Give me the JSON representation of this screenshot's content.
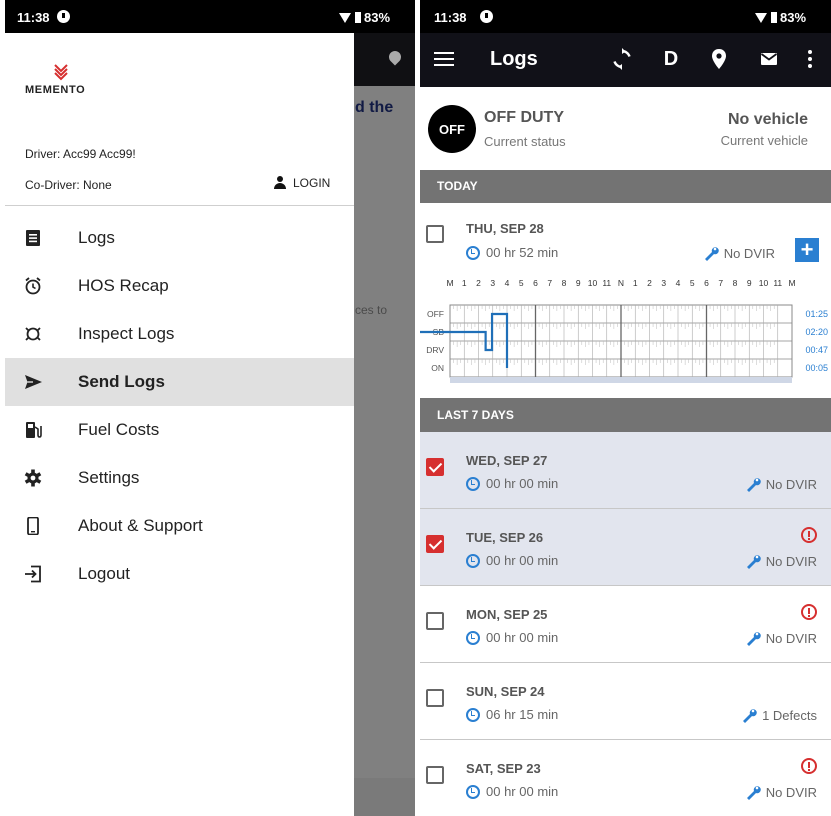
{
  "left_phone": {
    "status_bar": {
      "time": "11:38",
      "battery": "83%"
    },
    "behind": {
      "text1": "d the",
      "text2": "ces to"
    },
    "drawer": {
      "logo_text": "MEMENTO",
      "driver": "Driver: Acc99 Acc99!",
      "codriver": "Co-Driver: None",
      "login_label": "LOGIN",
      "menu": [
        {
          "label": "Logs",
          "icon": "list-icon"
        },
        {
          "label": "HOS Recap",
          "icon": "alarm-clock-icon"
        },
        {
          "label": "Inspect Logs",
          "icon": "inspect-icon"
        },
        {
          "label": "Send Logs",
          "icon": "send-icon",
          "active": true
        },
        {
          "label": "Fuel Costs",
          "icon": "fuel-pump-icon"
        },
        {
          "label": "Settings",
          "icon": "gear-icon"
        },
        {
          "label": "About & Support",
          "icon": "phone-icon"
        },
        {
          "label": "Logout",
          "icon": "logout-icon"
        }
      ]
    }
  },
  "right_phone": {
    "status_bar": {
      "time": "11:38",
      "battery": "83%"
    },
    "appbar": {
      "title": "Logs",
      "d_label": "D"
    },
    "status": {
      "circle": "OFF",
      "title": "OFF DUTY",
      "subtitle": "Current status",
      "vehicle_title": "No vehicle",
      "vehicle_subtitle": "Current vehicle"
    },
    "today_header": "TODAY",
    "today": {
      "date": "THU, SEP 28",
      "time": "00 hr  52 min",
      "dvir": "No DVIR",
      "graph": {
        "hour_labels": [
          "M",
          "1",
          "2",
          "3",
          "4",
          "5",
          "6",
          "7",
          "8",
          "9",
          "10",
          "11",
          "N",
          "1",
          "2",
          "3",
          "4",
          "5",
          "6",
          "7",
          "8",
          "9",
          "10",
          "11",
          "M"
        ],
        "rows": [
          "OFF",
          "SB",
          "DRV",
          "ON"
        ],
        "totals": [
          "01:25",
          "02:20",
          "00:47",
          "00:05"
        ]
      }
    },
    "last7_header": "LAST 7 DAYS",
    "days": [
      {
        "date": "WED, SEP 27",
        "time": "00 hr  00 min",
        "dvir": "No DVIR",
        "checked": true,
        "warning": false
      },
      {
        "date": "TUE, SEP 26",
        "time": "00 hr  00 min",
        "dvir": "No DVIR",
        "checked": true,
        "warning": true
      },
      {
        "date": "MON, SEP 25",
        "time": "00 hr  00 min",
        "dvir": "No DVIR",
        "checked": false,
        "warning": true
      },
      {
        "date": "SUN, SEP 24",
        "time": "06 hr  15 min",
        "dvir": "1 Defects",
        "checked": false,
        "warning": false
      },
      {
        "date": "SAT, SEP 23",
        "time": "00 hr  00 min",
        "dvir": "No DVIR",
        "checked": false,
        "warning": true
      }
    ],
    "colors": {
      "accent": "#2a7fd1",
      "danger": "#d62f2f",
      "appbar": "#111118"
    }
  }
}
